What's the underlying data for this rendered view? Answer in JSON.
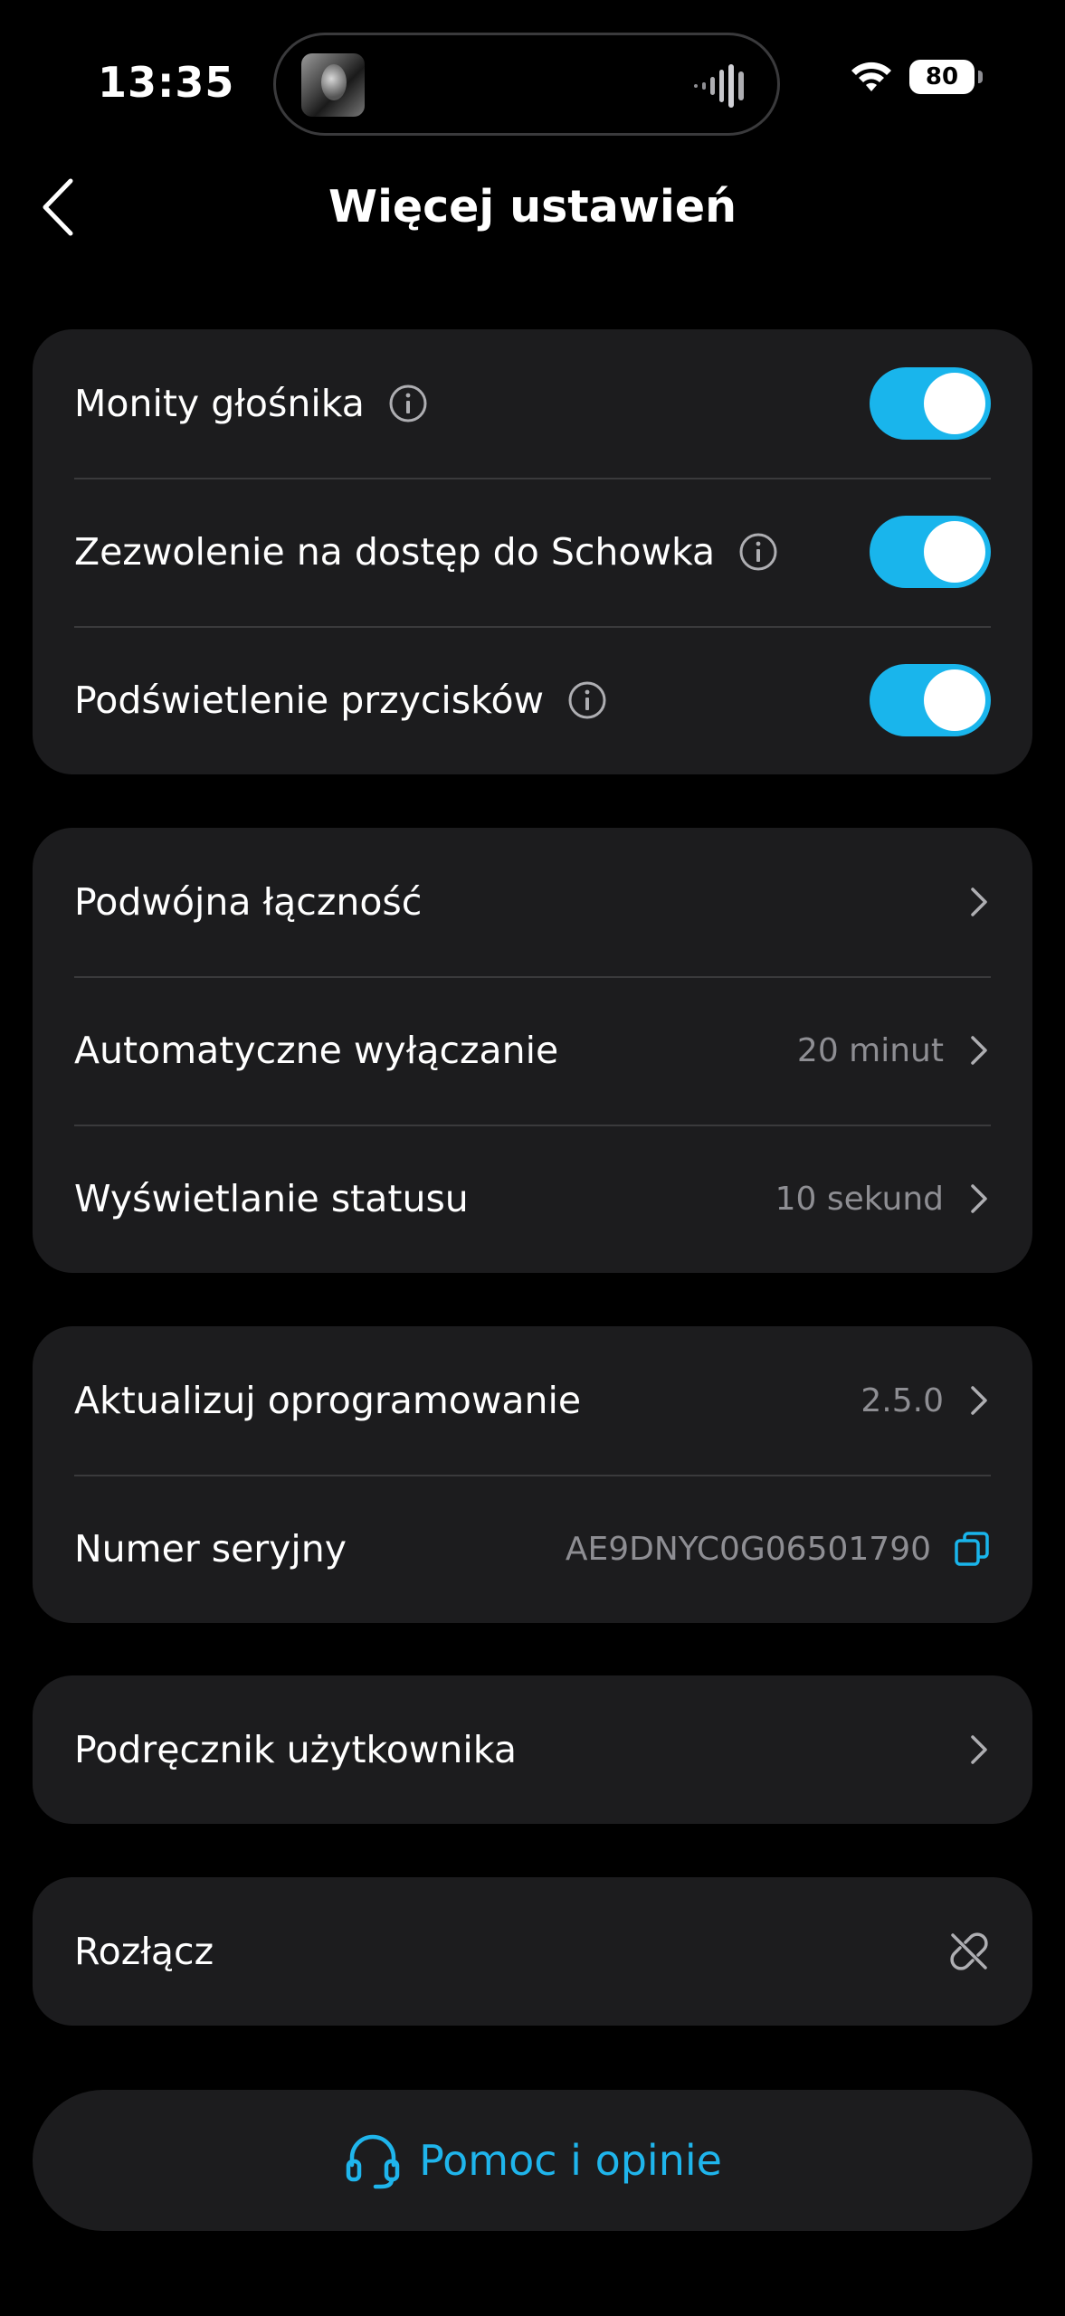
{
  "status_bar": {
    "time": "13:35",
    "battery": "80"
  },
  "header": {
    "title": "Więcej ustawień"
  },
  "toggles": [
    {
      "label": "Monity głośnika",
      "on": true
    },
    {
      "label": "Zezwolenie na dostęp do Schowka",
      "on": true
    },
    {
      "label": "Podświetlenie przycisków",
      "on": true
    }
  ],
  "connection": [
    {
      "label": "Podwójna łączność",
      "value": ""
    },
    {
      "label": "Automatyczne wyłączanie",
      "value": "20 minut"
    },
    {
      "label": "Wyświetlanie statusu",
      "value": "10 sekund"
    }
  ],
  "device": {
    "firmware_label": "Aktualizuj oprogramowanie",
    "firmware_value": "2.5.0",
    "serial_label": "Numer seryjny",
    "serial_value": "AE9DNYC0G06501790"
  },
  "manual": {
    "label": "Podręcznik użytkownika"
  },
  "disconnect": {
    "label": "Rozłącz"
  },
  "help": {
    "label": "Pomoc i opinie"
  },
  "colors": {
    "accent": "#19b5ec",
    "card": "#1c1c1e",
    "background": "#000000",
    "secondary_text": "#8e8e93"
  }
}
